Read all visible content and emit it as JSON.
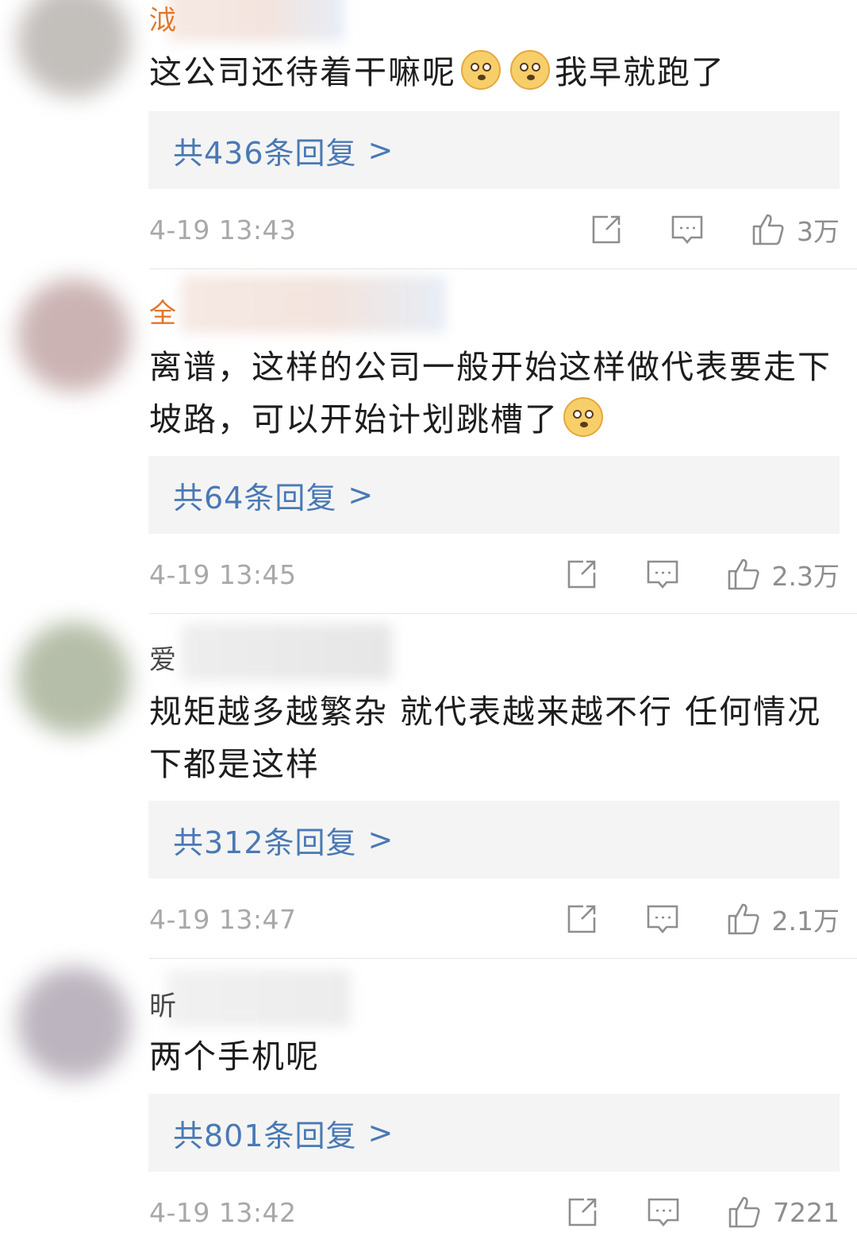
{
  "comments": [
    {
      "user_initial": "泧",
      "user_initial_color": "#e0772a",
      "avatar_color": "#b9b4b0",
      "text_before": "这公司还待着干嘛呢",
      "text_after": "我早就跑了",
      "emoji": "doge",
      "replies_label": "共436条回复",
      "replies_arrow": ">",
      "time": "4-19 13:43",
      "likes": "3万"
    },
    {
      "user_initial": "全",
      "user_initial_color": "#e0772a",
      "avatar_color": "#c2a6a6",
      "text_before": "离谱，这样的公司一般开始这样做代表要走下坡路，可以开始计划跳槽了",
      "emoji": "doge",
      "replies_label": "共64条回复",
      "replies_arrow": ">",
      "time": "4-19 13:45",
      "likes": "2.3万"
    },
    {
      "user_initial": "爱",
      "user_initial_color": "#4a4a4a",
      "avatar_color": "#a9b39a",
      "text_before": "规矩越多越繁杂 就代表越来越不行 任何情况下都是这样",
      "replies_label": "共312条回复",
      "replies_arrow": ">",
      "time": "4-19 13:47",
      "likes": "2.1万"
    },
    {
      "user_initial": "昕",
      "user_initial_color": "#4a4a4a",
      "avatar_color": "#b1a8b4",
      "text_before": "两个手机呢",
      "replies_label": "共801条回复",
      "replies_arrow": ">",
      "time": "4-19 13:42",
      "likes": "7221"
    }
  ],
  "icons": {
    "share": "share-icon",
    "comment": "comment-icon",
    "like": "like-icon"
  },
  "colors": {
    "link": "#4a79b4",
    "meta": "#a8a8a8",
    "reply_bg": "#f4f4f4"
  }
}
